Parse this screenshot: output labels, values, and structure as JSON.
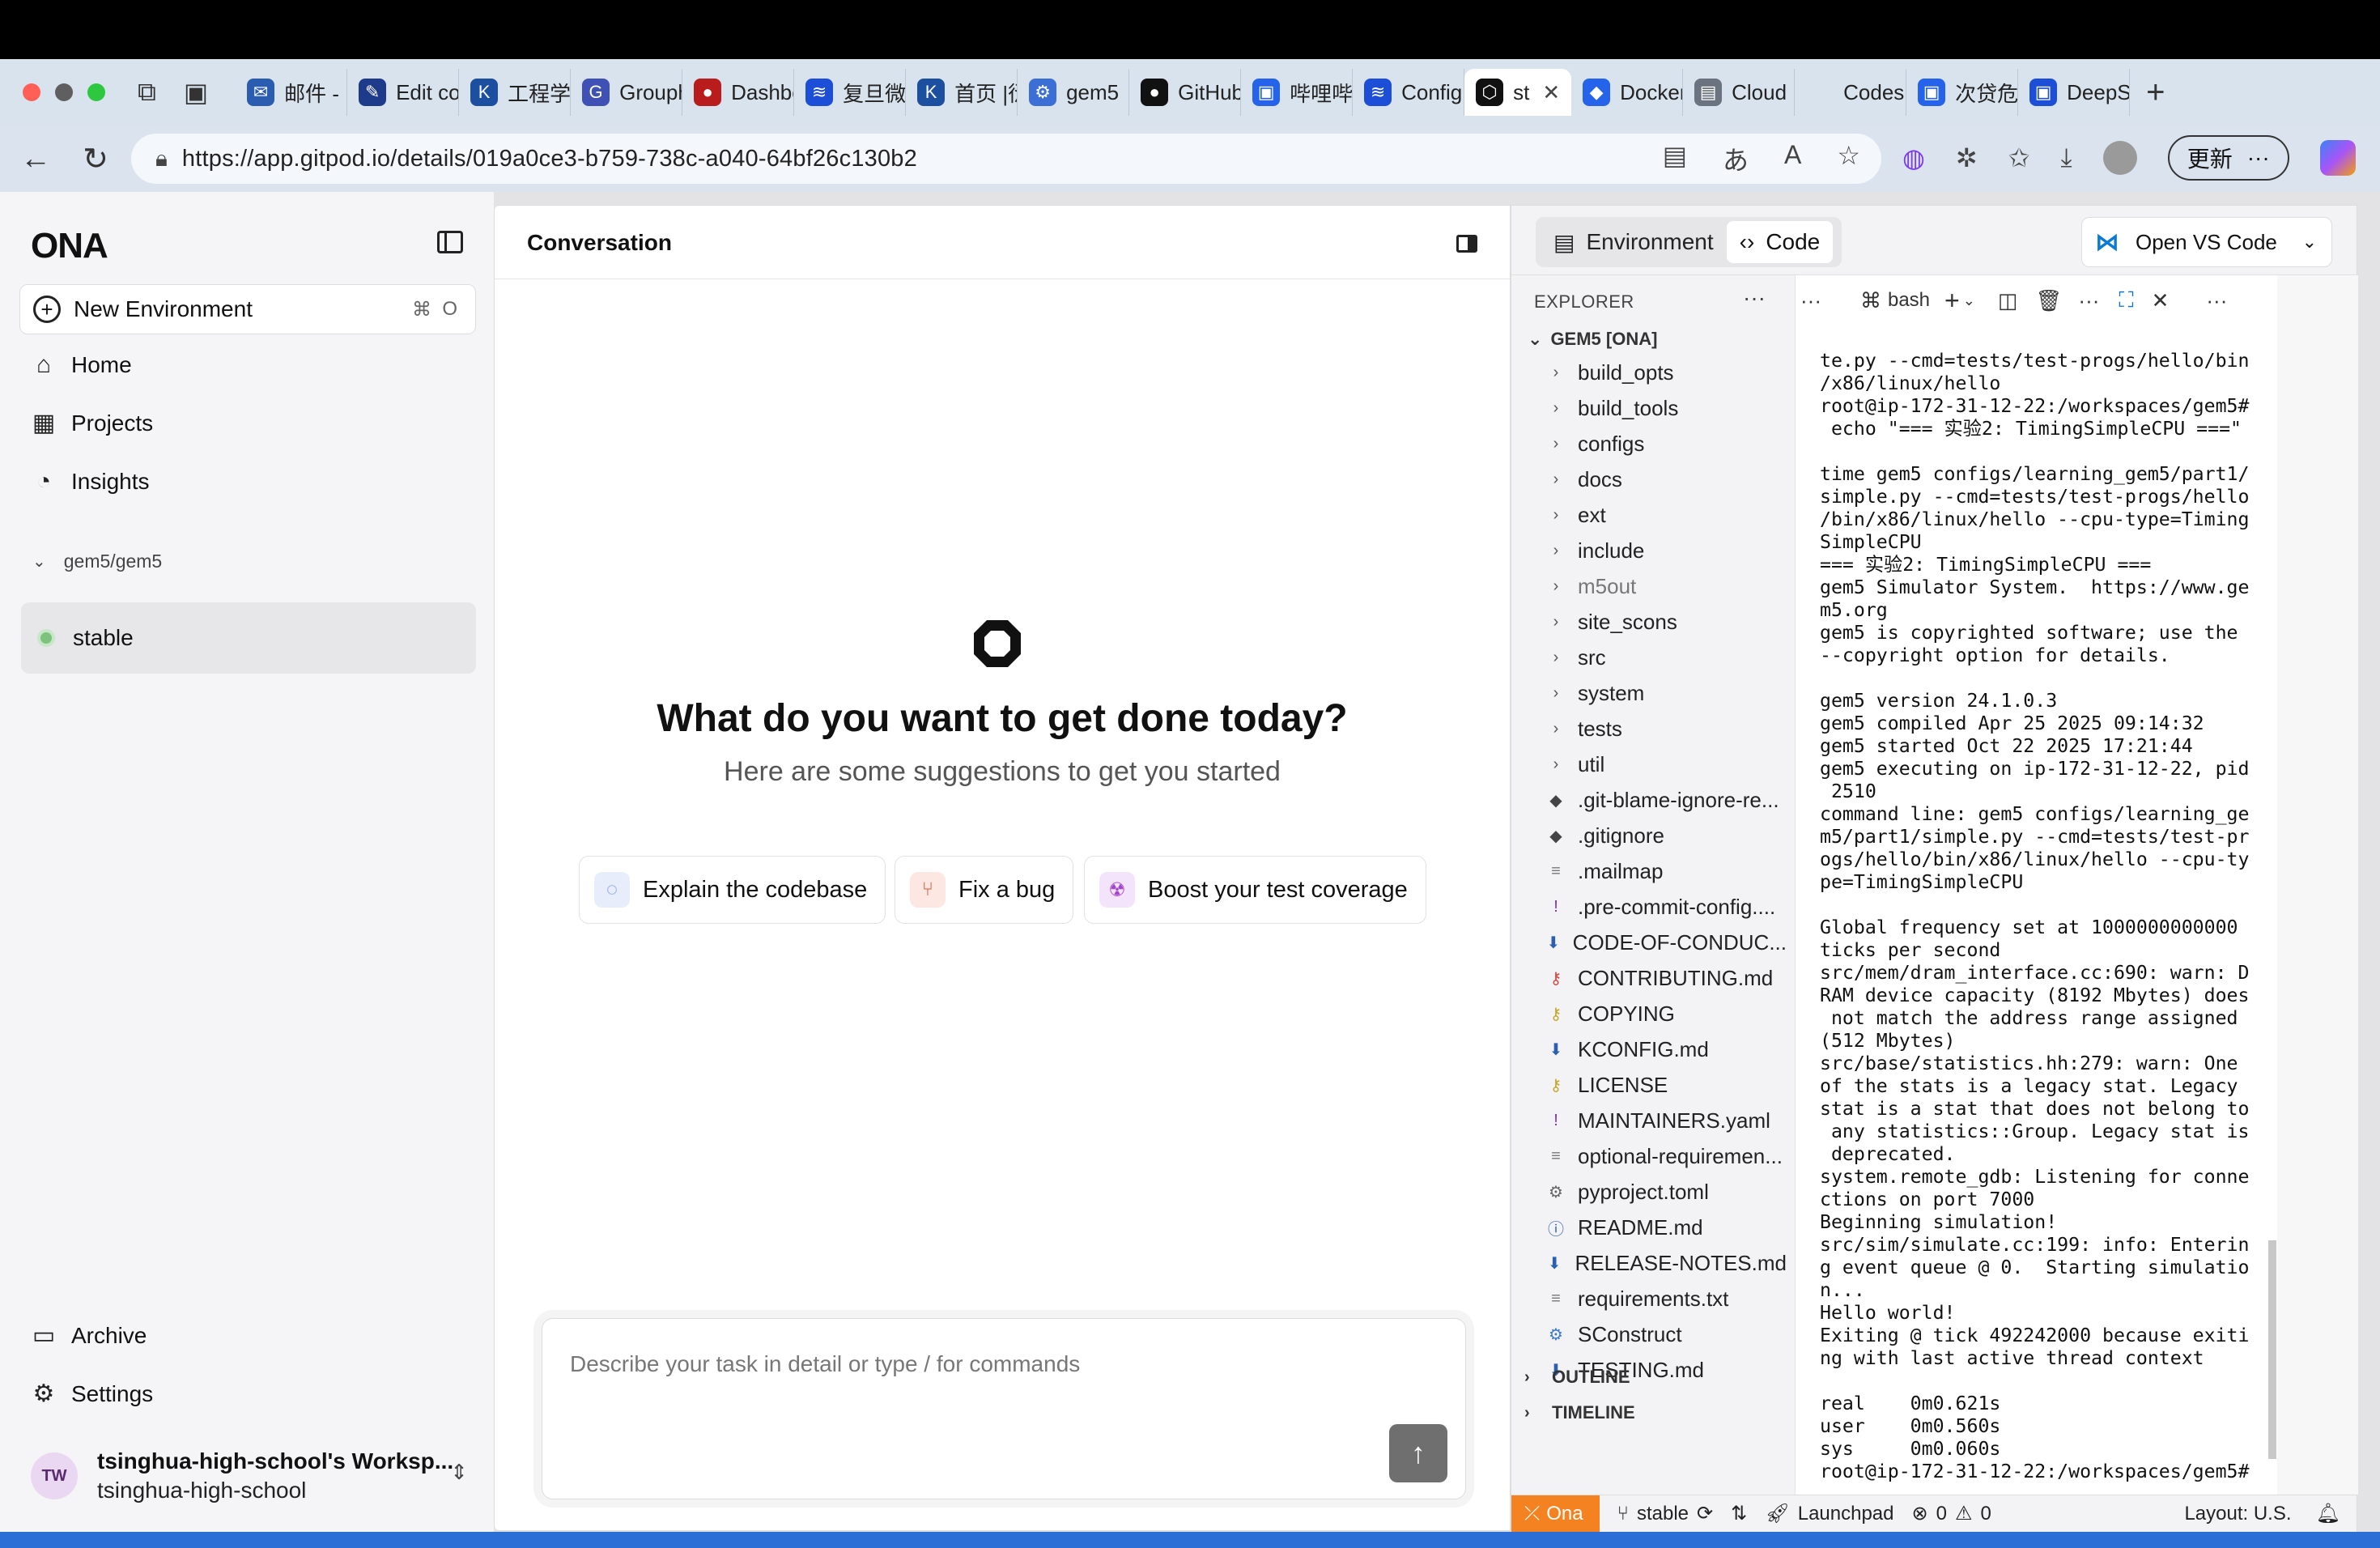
{
  "browser": {
    "tabs": [
      {
        "label": "邮件 - l",
        "color": "#2a5db0",
        "glyph": "✉"
      },
      {
        "label": "Edit co",
        "color": "#1e3a8a",
        "glyph": "✎"
      },
      {
        "label": "工程学",
        "color": "#1c4fa0",
        "glyph": "K"
      },
      {
        "label": "Grouph",
        "color": "#3f51b5",
        "glyph": "G"
      },
      {
        "label": "Dashbo",
        "color": "#b91c1c",
        "glyph": "●"
      },
      {
        "label": "复旦微",
        "color": "#1d4ed8",
        "glyph": "≋"
      },
      {
        "label": "首页 |衍",
        "color": "#1c4fa0",
        "glyph": "K"
      },
      {
        "label": "gem5",
        "color": "#3b6fd6",
        "glyph": "⚙"
      },
      {
        "label": "GitHub",
        "color": "#111",
        "glyph": "●"
      },
      {
        "label": "哔哩哔",
        "color": "#2563eb",
        "glyph": "▣"
      },
      {
        "label": "Config",
        "color": "#1d4ed8",
        "glyph": "≋"
      },
      {
        "label": "Docker",
        "color": "#2563eb",
        "glyph": "◆"
      },
      {
        "label": "Cloud",
        "color": "#6b7280",
        "glyph": "▤"
      },
      {
        "label": "Codes",
        "color": "#d9e3ee",
        "glyph": ""
      },
      {
        "label": "次贷危",
        "color": "#2563eb",
        "glyph": "▣"
      },
      {
        "label": "DeepS",
        "color": "#1d4ed8",
        "glyph": "▣"
      }
    ],
    "active_tab": {
      "label": "st",
      "close": "✕"
    },
    "url": "https://app.gitpod.io/details/019a0ce3-b759-738c-a040-64bf26c130b2",
    "update_label": "更新"
  },
  "sidebar": {
    "logo": "ONA",
    "new_env": {
      "label": "New Environment",
      "shortcut_a": "⌘",
      "shortcut_b": "O"
    },
    "nav": [
      {
        "label": "Home",
        "icon": "⌂"
      },
      {
        "label": "Projects",
        "icon": "▦"
      },
      {
        "label": "Insights",
        "icon": "◔"
      }
    ],
    "group": "gem5/gem5",
    "env": "stable",
    "bottom": [
      {
        "label": "Archive",
        "icon": "▭"
      },
      {
        "label": "Settings",
        "icon": "⚙"
      }
    ],
    "workspace": {
      "initials": "TW",
      "name": "tsinghua-high-school's Worksp...",
      "org": "tsinghua-high-school"
    }
  },
  "conversation": {
    "title": "Conversation",
    "hero": "What do you want to get done today?",
    "subtitle": "Here are some suggestions to get you started",
    "suggestions": [
      {
        "label": "Explain the codebase"
      },
      {
        "label": "Fix a bug"
      },
      {
        "label": "Boost your test coverage"
      }
    ],
    "placeholder": "Describe your task in detail or type / for commands"
  },
  "code_panel": {
    "tabs": [
      "Environment",
      "Code"
    ],
    "open_vscode": "Open VS Code",
    "explorer_title": "EXPLORER",
    "root": "GEM5 [ONA]",
    "files": [
      "build_opts",
      "build_tools",
      "configs",
      "docs",
      "ext",
      "include",
      "m5out",
      "site_scons",
      "src",
      "system",
      "tests",
      "util",
      ".git-blame-ignore-re...",
      ".gitignore",
      ".mailmap",
      ".pre-commit-config....",
      "CODE-OF-CONDUC...",
      "CONTRIBUTING.md",
      "COPYING",
      "KCONFIG.md",
      "LICENSE",
      "MAINTAINERS.yaml",
      "optional-requiremen...",
      "pyproject.toml",
      "README.md",
      "RELEASE-NOTES.md",
      "requirements.txt",
      "SConstruct",
      "TESTING.md"
    ],
    "outline": "OUTLINE",
    "timeline": "TIMELINE",
    "terminal_shell": "bash",
    "terminal_text": "te.py --cmd=tests/test-progs/hello/bin\n/x86/linux/hello\nroot@ip-172-31-12-22:/workspaces/gem5#\n echo \"=== 实验2: TimingSimpleCPU ===\"\n\ntime gem5 configs/learning_gem5/part1/\nsimple.py --cmd=tests/test-progs/hello\n/bin/x86/linux/hello --cpu-type=Timing\nSimpleCPU\n=== 实验2: TimingSimpleCPU ===\ngem5 Simulator System.  https://www.ge\nm5.org\ngem5 is copyrighted software; use the\n--copyright option for details.\n\ngem5 version 24.1.0.3\ngem5 compiled Apr 25 2025 09:14:32\ngem5 started Oct 22 2025 17:21:44\ngem5 executing on ip-172-31-12-22, pid\n 2510\ncommand line: gem5 configs/learning_ge\nm5/part1/simple.py --cmd=tests/test-pr\nogs/hello/bin/x86/linux/hello --cpu-ty\npe=TimingSimpleCPU\n\nGlobal frequency set at 1000000000000\nticks per second\nsrc/mem/dram_interface.cc:690: warn: D\nRAM device capacity (8192 Mbytes) does\n not match the address range assigned\n(512 Mbytes)\nsrc/base/statistics.hh:279: warn: One\nof the stats is a legacy stat. Legacy\nstat is a stat that does not belong to\n any statistics::Group. Legacy stat is\n deprecated.\nsystem.remote_gdb: Listening for conne\nctions on port 7000\nBeginning simulation!\nsrc/sim/simulate.cc:199: info: Enterin\ng event queue @ 0.  Starting simulatio\nn...\nHello world!\nExiting @ tick 492242000 because exiti\nng with last active thread context\n\nreal    0m0.621s\nuser    0m0.560s\nsys     0m0.060s\nroot@ip-172-31-12-22:/workspaces/gem5#",
    "status": {
      "ona": "Ona",
      "branch": "stable",
      "launchpad": "Launchpad",
      "errors": "0",
      "warnings": "0",
      "layout": "Layout: U.S."
    }
  }
}
